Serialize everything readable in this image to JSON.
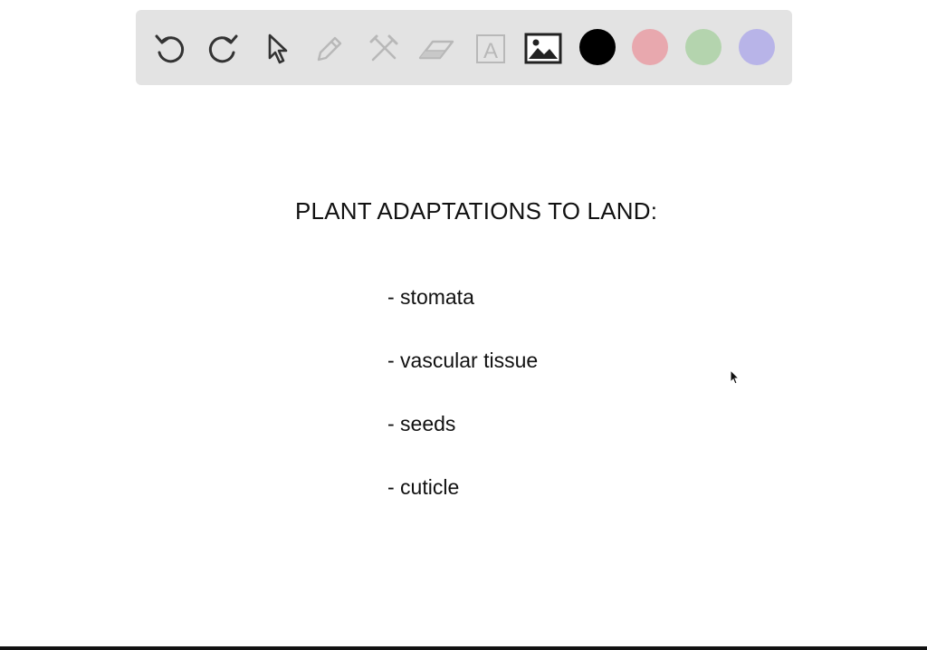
{
  "toolbar": {
    "tools": [
      {
        "name": "undo-icon"
      },
      {
        "name": "redo-icon"
      },
      {
        "name": "pointer-icon"
      },
      {
        "name": "pen-icon"
      },
      {
        "name": "tools-icon"
      },
      {
        "name": "eraser-icon"
      },
      {
        "name": "text-icon"
      },
      {
        "name": "image-icon"
      }
    ],
    "text_tool_glyph": "A",
    "colors": {
      "black": "#000000",
      "red": "#e8a8ae",
      "green": "#b4d4ae",
      "purple": "#b8b4e8"
    }
  },
  "canvas": {
    "title": "PLANT ADAPTATIONS TO LAND:",
    "items": [
      "- stomata",
      "- vascular tissue",
      "- seeds",
      "- cuticle"
    ]
  }
}
